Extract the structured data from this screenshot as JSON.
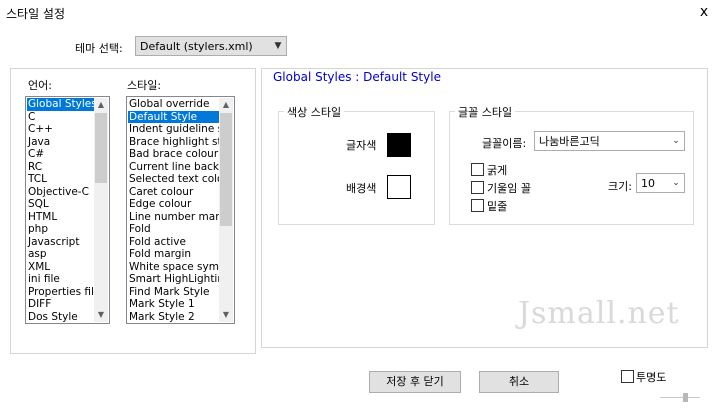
{
  "window": {
    "title": "스타일 설정",
    "close_glyph": "x"
  },
  "theme": {
    "label": "테마 선택:",
    "selected": "Default (stylers.xml)"
  },
  "languages": {
    "label": "언어:",
    "items": [
      "Global Styles",
      "C",
      "C++",
      "Java",
      "C#",
      "RC",
      "TCL",
      "Objective-C",
      "SQL",
      "HTML",
      "php",
      "Javascript",
      "asp",
      "XML",
      "ini file",
      "Properties file",
      "DIFF",
      "Dos Style"
    ],
    "selected_index": 0
  },
  "styles": {
    "label": "스타일:",
    "items": [
      "Global override",
      "Default Style",
      "Indent guideline style",
      "Brace highlight style",
      "Bad brace colour",
      "Current line background colour",
      "Selected text colour",
      "Caret colour",
      "Edge colour",
      "Line number margin",
      "Fold",
      "Fold active",
      "Fold margin",
      "White space symbol",
      "Smart HighLighting",
      "Find Mark Style",
      "Mark Style 1",
      "Mark Style 2"
    ],
    "selected_index": 1
  },
  "style_panel": {
    "heading": "Global Styles : Default Style"
  },
  "color_group": {
    "legend": "색상 스타일",
    "fg_label": "글자색",
    "bg_label": "배경색",
    "fg_color": "#000000",
    "bg_color": "#ffffff"
  },
  "font_group": {
    "legend": "글꼴 스타일",
    "font_label": "글꼴이름:",
    "font_value": "나눔바른고딕",
    "bold_label": "굵게",
    "italic_label": "기울임 꼴",
    "underline_label": "밑줄",
    "size_label": "크기:",
    "size_value": "10"
  },
  "watermark": "Jsmall.net",
  "buttons": {
    "save_close": "저장 후 닫기",
    "cancel": "취소"
  },
  "transparency": {
    "label": "투명도"
  }
}
